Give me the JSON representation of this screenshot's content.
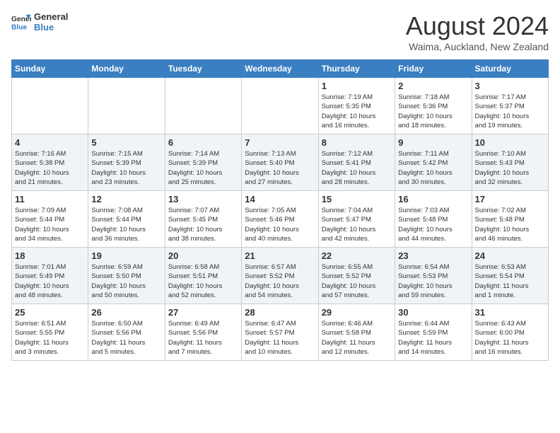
{
  "logo": {
    "line1": "General",
    "line2": "Blue"
  },
  "title": "August 2024",
  "location": "Waima, Auckland, New Zealand",
  "weekdays": [
    "Sunday",
    "Monday",
    "Tuesday",
    "Wednesday",
    "Thursday",
    "Friday",
    "Saturday"
  ],
  "weeks": [
    [
      {
        "day": "",
        "info": ""
      },
      {
        "day": "",
        "info": ""
      },
      {
        "day": "",
        "info": ""
      },
      {
        "day": "",
        "info": ""
      },
      {
        "day": "1",
        "info": "Sunrise: 7:19 AM\nSunset: 5:35 PM\nDaylight: 10 hours\nand 16 minutes."
      },
      {
        "day": "2",
        "info": "Sunrise: 7:18 AM\nSunset: 5:36 PM\nDaylight: 10 hours\nand 18 minutes."
      },
      {
        "day": "3",
        "info": "Sunrise: 7:17 AM\nSunset: 5:37 PM\nDaylight: 10 hours\nand 19 minutes."
      }
    ],
    [
      {
        "day": "4",
        "info": "Sunrise: 7:16 AM\nSunset: 5:38 PM\nDaylight: 10 hours\nand 21 minutes."
      },
      {
        "day": "5",
        "info": "Sunrise: 7:15 AM\nSunset: 5:39 PM\nDaylight: 10 hours\nand 23 minutes."
      },
      {
        "day": "6",
        "info": "Sunrise: 7:14 AM\nSunset: 5:39 PM\nDaylight: 10 hours\nand 25 minutes."
      },
      {
        "day": "7",
        "info": "Sunrise: 7:13 AM\nSunset: 5:40 PM\nDaylight: 10 hours\nand 27 minutes."
      },
      {
        "day": "8",
        "info": "Sunrise: 7:12 AM\nSunset: 5:41 PM\nDaylight: 10 hours\nand 28 minutes."
      },
      {
        "day": "9",
        "info": "Sunrise: 7:11 AM\nSunset: 5:42 PM\nDaylight: 10 hours\nand 30 minutes."
      },
      {
        "day": "10",
        "info": "Sunrise: 7:10 AM\nSunset: 5:43 PM\nDaylight: 10 hours\nand 32 minutes."
      }
    ],
    [
      {
        "day": "11",
        "info": "Sunrise: 7:09 AM\nSunset: 5:44 PM\nDaylight: 10 hours\nand 34 minutes."
      },
      {
        "day": "12",
        "info": "Sunrise: 7:08 AM\nSunset: 5:44 PM\nDaylight: 10 hours\nand 36 minutes."
      },
      {
        "day": "13",
        "info": "Sunrise: 7:07 AM\nSunset: 5:45 PM\nDaylight: 10 hours\nand 38 minutes."
      },
      {
        "day": "14",
        "info": "Sunrise: 7:05 AM\nSunset: 5:46 PM\nDaylight: 10 hours\nand 40 minutes."
      },
      {
        "day": "15",
        "info": "Sunrise: 7:04 AM\nSunset: 5:47 PM\nDaylight: 10 hours\nand 42 minutes."
      },
      {
        "day": "16",
        "info": "Sunrise: 7:03 AM\nSunset: 5:48 PM\nDaylight: 10 hours\nand 44 minutes."
      },
      {
        "day": "17",
        "info": "Sunrise: 7:02 AM\nSunset: 5:48 PM\nDaylight: 10 hours\nand 46 minutes."
      }
    ],
    [
      {
        "day": "18",
        "info": "Sunrise: 7:01 AM\nSunset: 5:49 PM\nDaylight: 10 hours\nand 48 minutes."
      },
      {
        "day": "19",
        "info": "Sunrise: 6:59 AM\nSunset: 5:50 PM\nDaylight: 10 hours\nand 50 minutes."
      },
      {
        "day": "20",
        "info": "Sunrise: 6:58 AM\nSunset: 5:51 PM\nDaylight: 10 hours\nand 52 minutes."
      },
      {
        "day": "21",
        "info": "Sunrise: 6:57 AM\nSunset: 5:52 PM\nDaylight: 10 hours\nand 54 minutes."
      },
      {
        "day": "22",
        "info": "Sunrise: 6:55 AM\nSunset: 5:52 PM\nDaylight: 10 hours\nand 57 minutes."
      },
      {
        "day": "23",
        "info": "Sunrise: 6:54 AM\nSunset: 5:53 PM\nDaylight: 10 hours\nand 59 minutes."
      },
      {
        "day": "24",
        "info": "Sunrise: 6:53 AM\nSunset: 5:54 PM\nDaylight: 11 hours\nand 1 minute."
      }
    ],
    [
      {
        "day": "25",
        "info": "Sunrise: 6:51 AM\nSunset: 5:55 PM\nDaylight: 11 hours\nand 3 minutes."
      },
      {
        "day": "26",
        "info": "Sunrise: 6:50 AM\nSunset: 5:56 PM\nDaylight: 11 hours\nand 5 minutes."
      },
      {
        "day": "27",
        "info": "Sunrise: 6:49 AM\nSunset: 5:56 PM\nDaylight: 11 hours\nand 7 minutes."
      },
      {
        "day": "28",
        "info": "Sunrise: 6:47 AM\nSunset: 5:57 PM\nDaylight: 11 hours\nand 10 minutes."
      },
      {
        "day": "29",
        "info": "Sunrise: 6:46 AM\nSunset: 5:58 PM\nDaylight: 11 hours\nand 12 minutes."
      },
      {
        "day": "30",
        "info": "Sunrise: 6:44 AM\nSunset: 5:59 PM\nDaylight: 11 hours\nand 14 minutes."
      },
      {
        "day": "31",
        "info": "Sunrise: 6:43 AM\nSunset: 6:00 PM\nDaylight: 11 hours\nand 16 minutes."
      }
    ]
  ]
}
